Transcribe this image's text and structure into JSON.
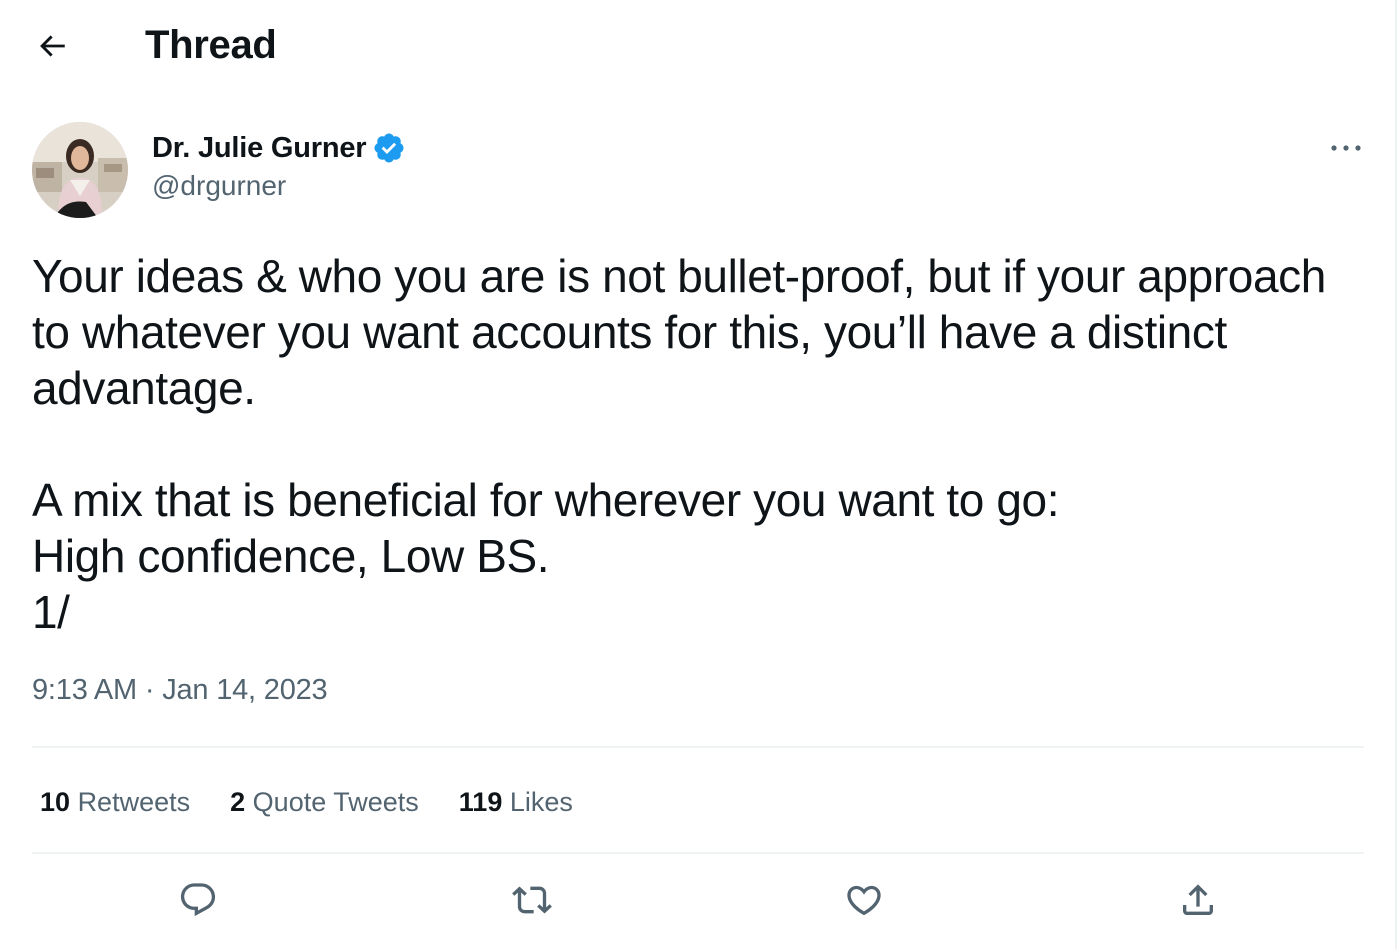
{
  "header": {
    "title": "Thread",
    "back_icon": "arrow-left-icon"
  },
  "tweet": {
    "author": {
      "name": "Dr. Julie Gurner",
      "handle": "@drgurner",
      "verified": true,
      "verified_color": "#1d9bf0"
    },
    "text_paragraphs": [
      "Your ideas & who you are is not bullet-proof, but if your approach to whatever you want accounts for this, you’ll have a distinct advantage.",
      "A mix that is beneficial for wherever you want to go:\nHigh confidence, Low BS.\n1/"
    ],
    "time": "9:13 AM",
    "separator": "·",
    "date": "Jan 14, 2023"
  },
  "stats": [
    {
      "count": "10",
      "label": "Retweets"
    },
    {
      "count": "2",
      "label": "Quote Tweets"
    },
    {
      "count": "119",
      "label": "Likes"
    }
  ],
  "actions": [
    {
      "icon": "reply-icon"
    },
    {
      "icon": "retweet-icon"
    },
    {
      "icon": "like-icon"
    },
    {
      "icon": "share-icon"
    }
  ],
  "colors": {
    "text_primary": "#0f1419",
    "text_secondary": "#536471",
    "accent": "#1d9bf0",
    "divider": "#eff3f4"
  }
}
